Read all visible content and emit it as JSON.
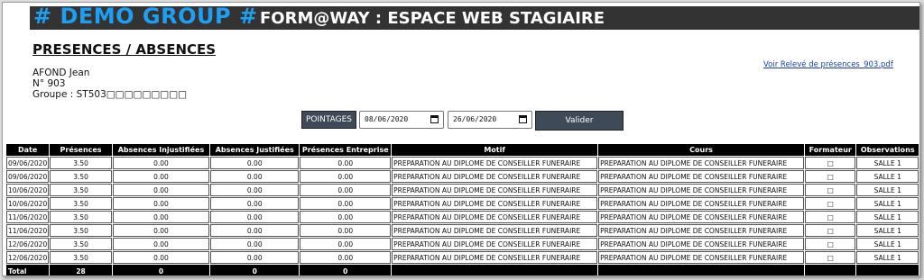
{
  "header": {
    "brand": "# DEMO GROUP #",
    "subtitle": "FORM@WAY : ESPACE WEB STAGIAIRE"
  },
  "page_title": "PRESENCES / ABSENCES",
  "student": {
    "name": "AFOND Jean",
    "number": "N° 903",
    "group": "Groupe : ST503□□□□□□□□□"
  },
  "pdf_link": "Voir Relevé de présences_903.pdf",
  "filter": {
    "pointages_label": "POINTAGES",
    "date_from": "08/06/2020",
    "date_to": "26/06/2020",
    "validate_label": "Valider"
  },
  "table": {
    "headers": [
      "Date",
      "Présences",
      "Absences Injustifiées",
      "Absences Justifiées",
      "Présences Entreprise",
      "Motif",
      "Cours",
      "Formateur",
      "Observations"
    ],
    "rows": [
      [
        "09/06/2020",
        "3.50",
        "0.00",
        "0.00",
        "0.00",
        "PREPARATION AU DIPLOME DE CONSEILLER FUNERAIRE",
        "PREPARATION AU DIPLOME DE CONSEILLER FUNERAIRE",
        "□",
        "SALLE 1"
      ],
      [
        "09/06/2020",
        "3.50",
        "0.00",
        "0.00",
        "0.00",
        "PREPARATION AU DIPLOME DE CONSEILLER FUNERAIRE",
        "PREPARATION AU DIPLOME DE CONSEILLER FUNERAIRE",
        "□",
        "SALLE 1"
      ],
      [
        "10/06/2020",
        "3.50",
        "0.00",
        "0.00",
        "0.00",
        "PREPARATION AU DIPLOME DE CONSEILLER FUNERAIRE",
        "PREPARATION AU DIPLOME DE CONSEILLER FUNERAIRE",
        "□",
        "SALLE 1"
      ],
      [
        "10/06/2020",
        "3.50",
        "0.00",
        "0.00",
        "0.00",
        "PREPARATION AU DIPLOME DE CONSEILLER FUNERAIRE",
        "PREPARATION AU DIPLOME DE CONSEILLER FUNERAIRE",
        "□",
        "SALLE 1"
      ],
      [
        "11/06/2020",
        "3.50",
        "0.00",
        "0.00",
        "0.00",
        "PREPARATION AU DIPLOME DE CONSEILLER FUNERAIRE",
        "PREPARATION AU DIPLOME DE CONSEILLER FUNERAIRE",
        "□",
        "SALLE 1"
      ],
      [
        "11/06/2020",
        "3.50",
        "0.00",
        "0.00",
        "0.00",
        "PREPARATION AU DIPLOME DE CONSEILLER FUNERAIRE",
        "PREPARATION AU DIPLOME DE CONSEILLER FUNERAIRE",
        "□",
        "SALLE 1"
      ],
      [
        "12/06/2020",
        "3.50",
        "0.00",
        "0.00",
        "0.00",
        "PREPARATION AU DIPLOME DE CONSEILLER FUNERAIRE",
        "PREPARATION AU DIPLOME DE CONSEILLER FUNERAIRE",
        "□",
        "SALLE 1"
      ],
      [
        "12/06/2020",
        "3.50",
        "0.00",
        "0.00",
        "0.00",
        "PREPARATION AU DIPLOME DE CONSEILLER FUNERAIRE",
        "PREPARATION AU DIPLOME DE CONSEILLER FUNERAIRE",
        "□",
        "SALLE 1"
      ]
    ],
    "totals": [
      "Total",
      "28",
      "0",
      "0",
      "0",
      "",
      "",
      "",
      ""
    ]
  },
  "colors": {
    "banner_bg": "#333333",
    "brand": "#1e9ff2",
    "button_bg": "#3e4a57",
    "link": "#1a3ea8"
  }
}
